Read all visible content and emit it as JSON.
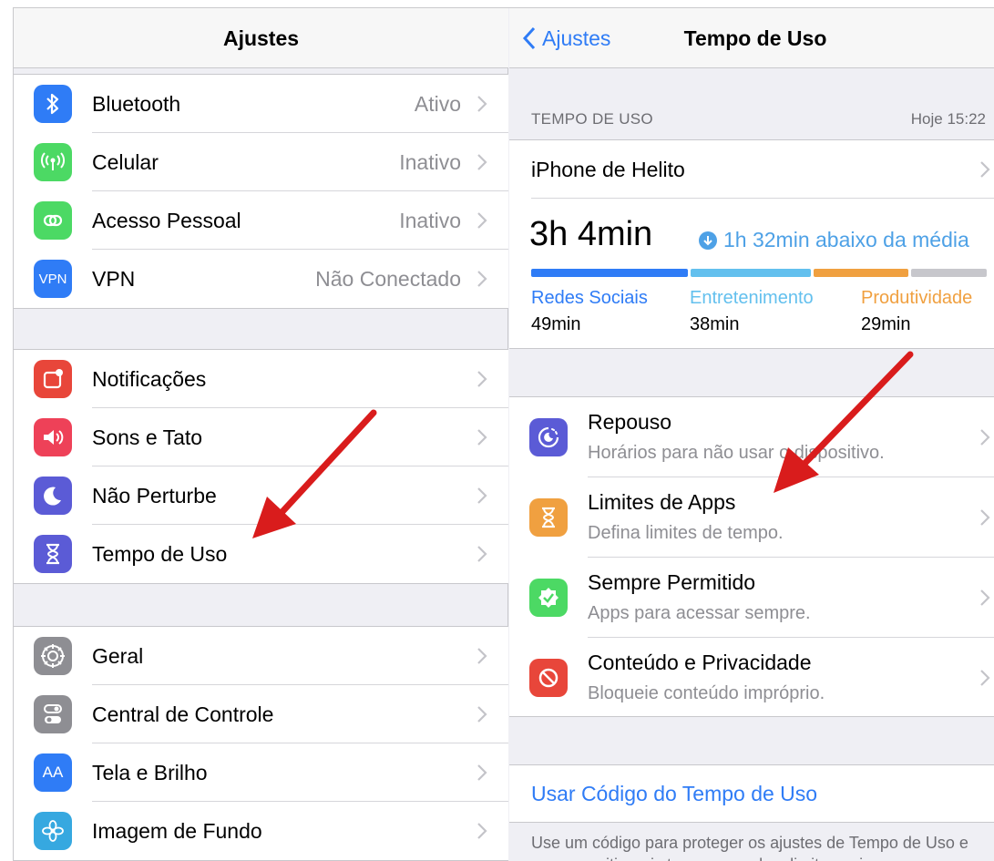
{
  "colors": {
    "accent_blue": "#2f7cf6",
    "bluetooth": "#2f7cf6",
    "cellular": "#4cd964",
    "hotspot": "#4cd964",
    "vpn": "#2f7cf6",
    "notifications": "#e8463a",
    "sounds": "#ee4158",
    "dnd": "#5b5bd6",
    "screen_time": "#5b5bd6",
    "general": "#8e8e93",
    "control_center": "#8e8e93",
    "display": "#2f7cf6",
    "wallpaper": "#36a8e0",
    "social": "#2f7cf6",
    "entertainment": "#63c0ee",
    "productivity": "#f0a040",
    "other": "#c7c7cc",
    "downtime": "#5b5bd6",
    "app_limits": "#f0a040",
    "always_allowed": "#4cd964",
    "restrictions": "#e8463a",
    "annotation_arrow": "#d91c1c"
  },
  "left": {
    "title": "Ajustes",
    "groups": [
      [
        {
          "label": "Bluetooth",
          "value": "Ativo",
          "icon": "bluetooth-icon"
        },
        {
          "label": "Celular",
          "value": "Inativo",
          "icon": "antenna-icon"
        },
        {
          "label": "Acesso Pessoal",
          "value": "Inativo",
          "icon": "hotspot-icon"
        },
        {
          "label": "VPN",
          "value": "Não Conectado",
          "icon": "vpn-icon",
          "icon_text": "VPN"
        }
      ],
      [
        {
          "label": "Notificações",
          "value": "",
          "icon": "notifications-icon"
        },
        {
          "label": "Sons e Tato",
          "value": "",
          "icon": "speaker-icon"
        },
        {
          "label": "Não Perturbe",
          "value": "",
          "icon": "moon-icon"
        },
        {
          "label": "Tempo de Uso",
          "value": "",
          "icon": "hourglass-icon"
        }
      ],
      [
        {
          "label": "Geral",
          "value": "",
          "icon": "gear-icon"
        },
        {
          "label": "Central de Controle",
          "value": "",
          "icon": "toggles-icon"
        },
        {
          "label": "Tela e Brilho",
          "value": "",
          "icon": "text-size-icon",
          "icon_text": "AA"
        },
        {
          "label": "Imagem de Fundo",
          "value": "",
          "icon": "flower-icon"
        }
      ]
    ]
  },
  "right": {
    "back_label": "Ajustes",
    "title": "Tempo de Uso",
    "section_header": "TEMPO DE USO",
    "section_time": "Hoje 15:22",
    "device": "iPhone de Helito",
    "total": "3h 4min",
    "avg_note": "1h 32min abaixo da média",
    "usage_fractions": {
      "social": 0.35,
      "entertainment": 0.27,
      "productivity": 0.21,
      "other": 0.17
    },
    "categories": [
      {
        "name": "Redes Sociais",
        "time": "49min",
        "color": "#2f7cf6"
      },
      {
        "name": "Entretenimento",
        "time": "38min",
        "color": "#63c0ee"
      },
      {
        "name": "Produtividade",
        "time": "29min",
        "color": "#f0a040"
      }
    ],
    "options": [
      {
        "title": "Repouso",
        "subtitle": "Horários para não usar o dispositivo.",
        "icon": "downtime-icon"
      },
      {
        "title": "Limites de Apps",
        "subtitle": "Defina limites de tempo.",
        "icon": "hourglass-icon"
      },
      {
        "title": "Sempre Permitido",
        "subtitle": "Apps para acessar sempre.",
        "icon": "checkmark-badge-icon"
      },
      {
        "title": "Conteúdo e Privacidade",
        "subtitle": "Bloqueie conteúdo impróprio.",
        "icon": "restricted-icon"
      }
    ],
    "passcode_label": "Usar Código do Tempo de Uso",
    "passcode_footer": "Use um código para proteger os ajustes de Tempo de Uso e para permitir mais tempo quando o limite expirar."
  }
}
